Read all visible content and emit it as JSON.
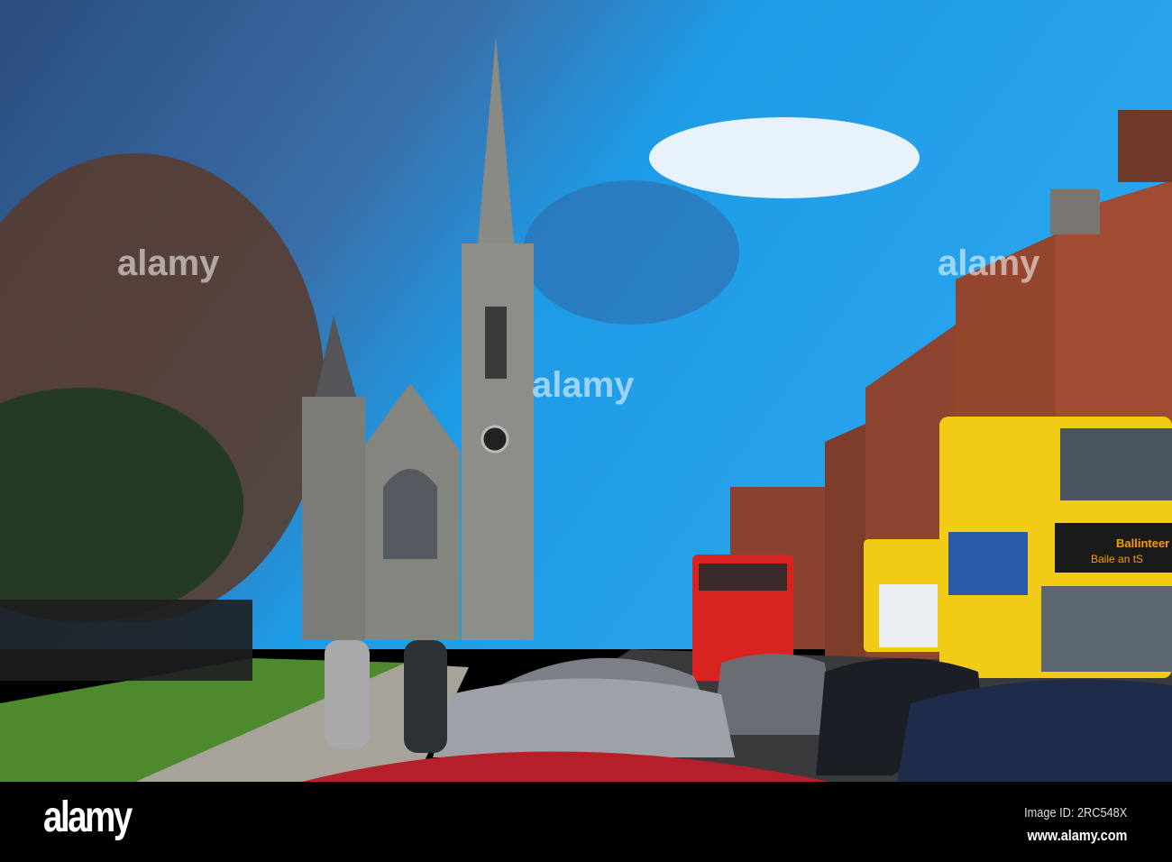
{
  "photo": {
    "bus_destination": "Ballinteer",
    "bus_destination_irish": "Baile an tS",
    "colors": {
      "sky": "#1e9be6",
      "cloud_dark": "#3a5a86",
      "brick": "#9c4a30",
      "bus_yellow": "#f2cc14",
      "bus_red": "#d8231f",
      "stone": "#8e8e88",
      "grass": "#4d8a2e"
    }
  },
  "watermark": {
    "text": "alamy"
  },
  "footer": {
    "logo": "alamy",
    "image_id": "Image ID: 2RC548X",
    "website": "www.alamy.com"
  }
}
